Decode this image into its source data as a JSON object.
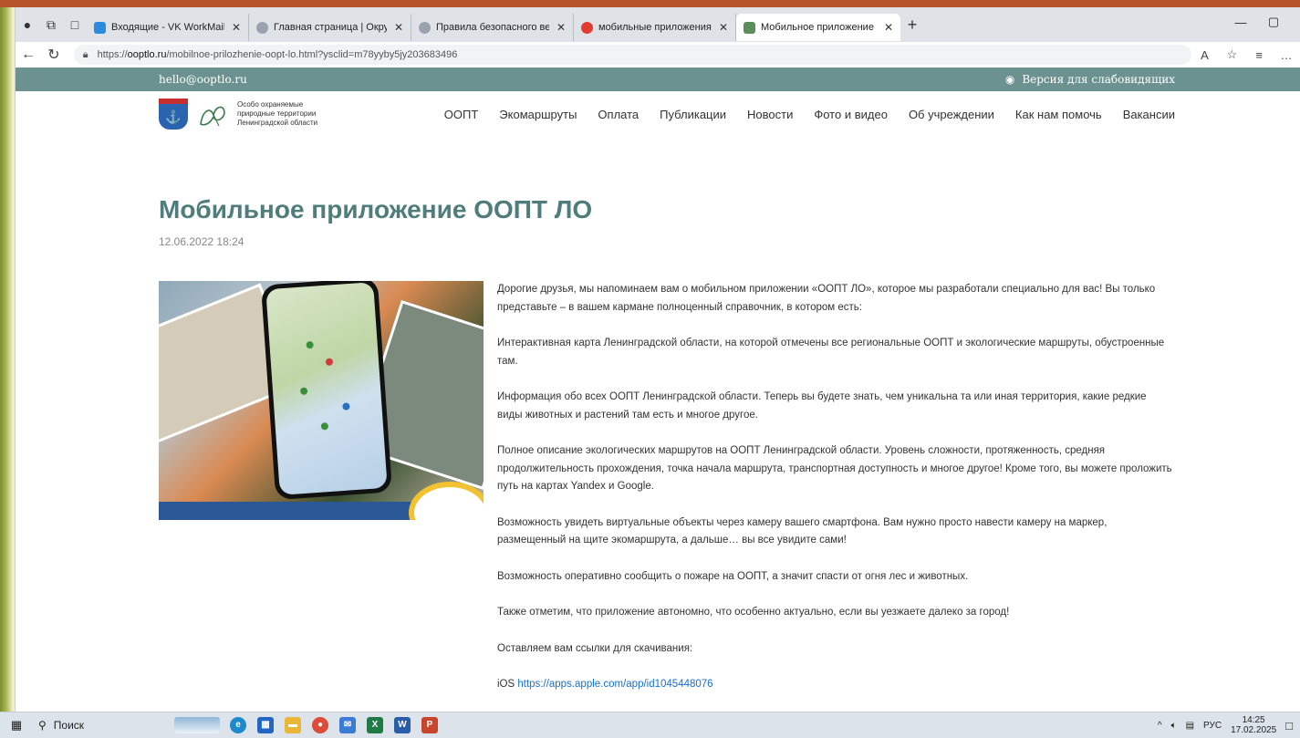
{
  "browser": {
    "tabs": [
      {
        "label": "Входящие - VK WorkMail",
        "color": "#2a8be0"
      },
      {
        "label": "Главная страница | Окружающи",
        "color": "#9aa3ad"
      },
      {
        "label": "Правила безопасного ведения г",
        "color": "#9aa3ad"
      },
      {
        "label": "мобильные приложения Заповс",
        "color": "#e23b30"
      },
      {
        "label": "Мобильное приложение ООПТ",
        "color": "#5b8e5a"
      }
    ],
    "url_prefix": "https://",
    "url_host": "ooptlo.ru",
    "url_path": "/mobilnoe-prilozhenie-oopt-lo.html?ysclid=m78yyby5jy203683496"
  },
  "site": {
    "email": "hello@ooptlo.ru",
    "vision_label": "Версия для слабовидящих",
    "logo_text": "Особо охраняемые природные территории Ленинградской области",
    "nav": [
      "ООПТ",
      "Экомаршруты",
      "Оплата",
      "Публикации",
      "Новости",
      "Фото и видео",
      "Об учреждении",
      "Как нам помочь",
      "Вакансии"
    ]
  },
  "article": {
    "title": "Мобильное приложение ООПТ ЛО",
    "date": "12.06.2022 18:24",
    "paragraphs": [
      "Дорогие друзья, мы напоминаем вам о мобильном приложении «ООПТ ЛО», которое мы разработали специально для вас! Вы только представьте – в вашем кармане полноценный справочник, в котором есть:",
      " Интерактивная карта Ленинградской области, на которой отмечены все региональные ООПТ и экологические маршруты, обустроенные там.",
      " Информация обо всех ООПТ Ленинградской области. Теперь вы будете знать, чем уникальна та или иная территория, какие редкие виды животных и растений там есть и многое другое.",
      " Полное описание экологических маршрутов на ООПТ Ленинградской области. Уровень сложности, протяженность, средняя продолжительность прохождения, точка начала маршрута, транспортная доступность и многое другое! Кроме того, вы можете проложить путь на картах Yandex и Google.",
      " Возможность увидеть виртуальные объекты через камеру вашего смартфона. Вам нужно просто навести камеру на маркер, размещенный на щите экомаршрута, а дальше… вы все увидите сами!",
      " Возможность оперативно сообщить о пожаре на ООПТ, а значит спасти от огня лес и животных.",
      "Также отметим, что приложение автономно, что особенно актуально, если вы уезжаете далеко за город!",
      "Оставляем вам ссылки для скачивания:"
    ],
    "ios_label": " iOS ",
    "ios_link": "https://apps.apple.com/app/id1045448076"
  },
  "taskbar": {
    "search_label": "Поиск",
    "lang": "РУС",
    "time": "14:25",
    "date": "17.02.2025"
  }
}
